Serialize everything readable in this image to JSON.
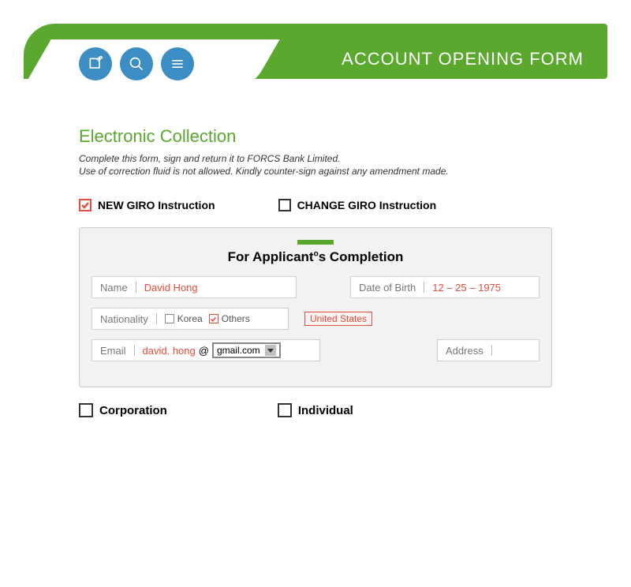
{
  "header": {
    "title": "ACCOUNT OPENING FORM"
  },
  "section": {
    "title": "Electronic Collection",
    "instructions1": "Complete this form, sign and return it to FORCS Bank Limited.",
    "instructions2": "Use of correction fluid is not allowed. Kindly counter-sign against any amendment made."
  },
  "giro": {
    "new_label": "NEW GIRO Instruction",
    "change_label": "CHANGE GIRO Instruction"
  },
  "panel": {
    "title_left": "For Applicant",
    "title_right": "s Completion",
    "name_label": "Name",
    "name_value": "David Hong",
    "dob_label": "Date of Birth",
    "dob_value": "12 – 25 – 1975",
    "nationality_label": "Nationality",
    "korea_label": "Korea",
    "others_label": "Others",
    "others_value": "United States",
    "email_label": "Email",
    "email_value": "david. hong",
    "at": "@",
    "email_domain": "gmail.com",
    "address_label": "Address"
  },
  "account_type": {
    "corporation_label": "Corporation",
    "individual_label": "Individual"
  }
}
